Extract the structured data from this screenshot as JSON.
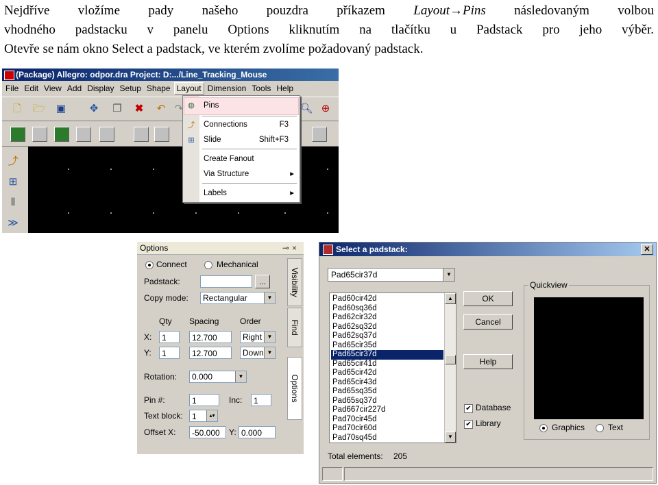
{
  "paragraph": {
    "line1_before": "Nejdříve vložíme pady našeho pouzdra příkazem ",
    "line1_cmd": "Layout→Pins",
    "line1_after": " následovaným volbou",
    "line2": "vhodného padstacku v panelu Options kliknutím na tlačítku u Padstack pro jeho výběr.",
    "line3": "Otevře se nám okno Select a padstack, ve kterém zvolíme požadovaný padstack."
  },
  "allegro": {
    "title": "(Package) Allegro: odpor.dra  Project: D:.../Line_Tracking_Mouse",
    "menus": [
      "File",
      "Edit",
      "View",
      "Add",
      "Display",
      "Setup",
      "Shape",
      "Layout",
      "Dimension",
      "Tools",
      "Help"
    ],
    "active_menu": "Layout",
    "layout_menu": {
      "pins": "Pins",
      "connections": "Connections",
      "connections_shortcut": "F3",
      "slide": "Slide",
      "slide_shortcut": "Shift+F3",
      "create_fanout": "Create Fanout",
      "via_structure": "Via Structure",
      "labels": "Labels"
    }
  },
  "options_panel": {
    "title": "Options",
    "radio_connect": "Connect",
    "radio_mechanical": "Mechanical",
    "padstack_label": "Padstack:",
    "padstack_value": "",
    "browse_button": "...",
    "copy_mode_label": "Copy mode:",
    "copy_mode_value": "Rectangular",
    "col_qty": "Qty",
    "col_spacing": "Spacing",
    "col_order": "Order",
    "x_label": "X:",
    "x_qty": "1",
    "x_spacing": "12.700",
    "x_order": "Right",
    "y_label": "Y:",
    "y_qty": "1",
    "y_spacing": "12.700",
    "y_order": "Down",
    "rotation_label": "Rotation:",
    "rotation_value": "0.000",
    "pin_label": "Pin #:",
    "pin_value": "1",
    "inc_label": "Inc:",
    "inc_value": "1",
    "text_block_label": "Text block:",
    "text_block_value": "1",
    "offset_x_label": "Offset X:",
    "offset_x_value": "-50.000",
    "offset_y_label": "Y:",
    "offset_y_value": "0.000",
    "tabs": [
      "Visibility",
      "Find",
      "Options"
    ]
  },
  "padstack_dialog": {
    "title": "Select a padstack:",
    "combo_value": "Pad65cir37d",
    "items": [
      "Pad60cir42d",
      "Pad60sq36d",
      "Pad62cir32d",
      "Pad62sq32d",
      "Pad62sq37d",
      "Pad65cir35d",
      "Pad65cir37d",
      "Pad65cir41d",
      "Pad65cir42d",
      "Pad65cir43d",
      "Pad65sq35d",
      "Pad65sq37d",
      "Pad667cir227d",
      "Pad70cir45d",
      "Pad70cir60d",
      "Pad70sq45d"
    ],
    "selected_item": "Pad65cir37d",
    "ok": "OK",
    "cancel": "Cancel",
    "help": "Help",
    "database": "Database",
    "library": "Library",
    "quickview": "Quickview",
    "graphics": "Graphics",
    "text": "Text",
    "total_label": "Total elements:",
    "total_value": "205"
  }
}
